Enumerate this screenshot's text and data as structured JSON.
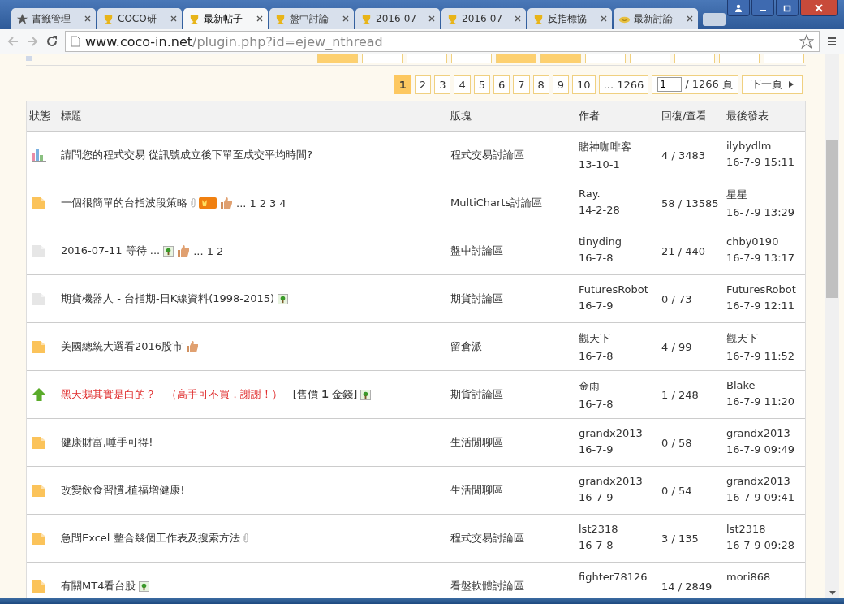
{
  "tabs": [
    {
      "kind": "star",
      "label": "書籤管理",
      "selected": false
    },
    {
      "kind": "trophy",
      "label": "COCO研",
      "selected": false
    },
    {
      "kind": "trophy",
      "label": "最新帖子",
      "selected": true
    },
    {
      "kind": "trophy",
      "label": "盤中討論",
      "selected": false
    },
    {
      "kind": "trophy",
      "label": "2016-07",
      "selected": false
    },
    {
      "kind": "trophy",
      "label": "2016-07",
      "selected": false
    },
    {
      "kind": "trophy",
      "label": "反指標協",
      "selected": false
    },
    {
      "kind": "smile",
      "label": "最新討論",
      "selected": false
    }
  ],
  "address": {
    "domain": "www.coco-in.net",
    "path": "/plugin.php?id=ejew_nthread"
  },
  "filters": [
    {
      "selected": true
    },
    {
      "selected": false
    },
    {
      "selected": false
    },
    {
      "selected": false
    },
    {
      "selected": true
    },
    {
      "selected": true
    },
    {
      "selected": false
    },
    {
      "selected": false
    },
    {
      "selected": false
    },
    {
      "selected": false
    },
    {
      "selected": false
    }
  ],
  "pagination": {
    "pages": [
      {
        "label": "1",
        "selected": true
      },
      {
        "label": "2",
        "selected": false
      },
      {
        "label": "3",
        "selected": false
      },
      {
        "label": "4",
        "selected": false
      },
      {
        "label": "5",
        "selected": false
      },
      {
        "label": "6",
        "selected": false
      },
      {
        "label": "7",
        "selected": false
      },
      {
        "label": "8",
        "selected": false
      },
      {
        "label": "9",
        "selected": false
      },
      {
        "label": "10",
        "selected": false
      },
      {
        "label": "... 1266",
        "selected": false
      }
    ],
    "page_input": "1",
    "total": "/ 1266 頁",
    "next": "下一頁"
  },
  "table": {
    "columns": [
      "狀態",
      "標題",
      "版塊",
      "作者",
      "回復/查看",
      "最後發表"
    ],
    "rows": [
      {
        "kind": "poll",
        "title": "請問您的程式交易 從訊號成立後下單至成交平均時間?",
        "highlighted": false,
        "attachment": false,
        "hot": false,
        "liked": false,
        "image": false,
        "pages": [],
        "forum": "程式交易討論區",
        "author": "賭神咖啡客",
        "author_date": "13-10-1",
        "stats": "4 / 3483",
        "last_user": "ilybydlm",
        "last_time": "16-7-9 15:11"
      },
      {
        "kind": "new",
        "title": "一個很簡單的台指波段策略",
        "highlighted": false,
        "attachment": true,
        "hot": true,
        "liked": true,
        "image": false,
        "pages_ellipsis": "...",
        "pages": [
          "1",
          "2",
          "3",
          "4"
        ],
        "forum": "MultiCharts討論區",
        "author": "Ray.",
        "author_date": "14-2-28",
        "stats": "58 / 13585",
        "last_user": "星星",
        "last_time": "16-7-9 13:29"
      },
      {
        "kind": "read",
        "title": "2016-07-11 等待 ...",
        "highlighted": false,
        "attachment": false,
        "hot": false,
        "liked": true,
        "image": true,
        "pages_ellipsis": "...",
        "pages": [
          "1",
          "2"
        ],
        "forum": "盤中討論區",
        "author": "tinyding",
        "author_date": "16-7-8",
        "stats": "21 / 440",
        "last_user": "chby0190",
        "last_time": "16-7-9 13:17"
      },
      {
        "kind": "read",
        "title": "期貨機器人 - 台指期-日K線資料(1998-2015)",
        "highlighted": false,
        "attachment": false,
        "hot": false,
        "liked": false,
        "image": true,
        "pages": [],
        "forum": "期貨討論區",
        "author": "FuturesRobot",
        "author_date": "16-7-9",
        "stats": "0 / 73",
        "last_user": "FuturesRobot",
        "last_time": "16-7-9 12:11"
      },
      {
        "kind": "new",
        "title": "美國總統大選看2016股市",
        "highlighted": false,
        "attachment": false,
        "hot": false,
        "liked": true,
        "image": false,
        "pages": [],
        "forum": "留倉派",
        "author": "觀天下",
        "author_date": "16-7-8",
        "stats": "4 / 99",
        "last_user": "觀天下",
        "last_time": "16-7-9 11:52"
      },
      {
        "kind": "up",
        "title": "黑天鵝其實是白的？　（高手可不買，謝謝！）",
        "suffix": " - [售價 **1** 金錢]",
        "highlighted": true,
        "attachment": false,
        "hot": false,
        "liked": false,
        "image": true,
        "pages": [],
        "forum": "期貨討論區",
        "author": "金雨",
        "author_date": "16-7-8",
        "stats": "1 / 248",
        "last_user": "Blake",
        "last_time": "16-7-9 11:20"
      },
      {
        "kind": "new",
        "title": "健康財富,唾手可得!",
        "highlighted": false,
        "attachment": false,
        "hot": false,
        "liked": false,
        "image": false,
        "pages": [],
        "forum": "生活閒聊區",
        "author": "grandx2013",
        "author_date": "16-7-9",
        "stats": "0 / 58",
        "last_user": "grandx2013",
        "last_time": "16-7-9 09:49"
      },
      {
        "kind": "new",
        "title": "改變飲食習慣,植福增健康!",
        "highlighted": false,
        "attachment": false,
        "hot": false,
        "liked": false,
        "image": false,
        "pages": [],
        "forum": "生活閒聊區",
        "author": "grandx2013",
        "author_date": "16-7-9",
        "stats": "0 / 54",
        "last_user": "grandx2013",
        "last_time": "16-7-9 09:41"
      },
      {
        "kind": "new",
        "title": "急問Excel 整合幾個工作表及搜索方法",
        "highlighted": false,
        "attachment": true,
        "hot": false,
        "liked": false,
        "image": false,
        "pages": [],
        "forum": "程式交易討論區",
        "author": "lst2318",
        "author_date": "16-7-8",
        "stats": "3 / 135",
        "last_user": "lst2318",
        "last_time": "16-7-9 09:28"
      },
      {
        "kind": "new",
        "title": "有關MT4看台股",
        "highlighted": false,
        "attachment": false,
        "hot": false,
        "liked": false,
        "image": true,
        "pages": [],
        "forum": "看盤軟體討論區",
        "author": "fighter78126",
        "stats": "14 / 2849",
        "last_user": "mori868"
      }
    ]
  }
}
